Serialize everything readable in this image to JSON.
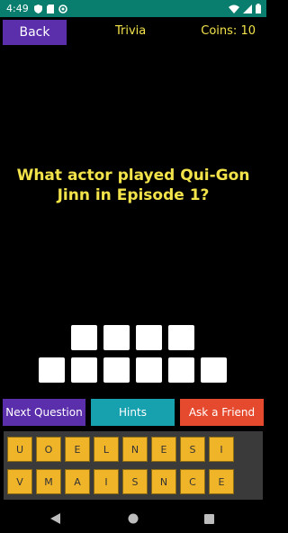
{
  "status_bar": {
    "time": "4:49",
    "icons": [
      "shield-icon",
      "sd-card-icon",
      "notification-icon",
      "wifi-icon",
      "signal-icon",
      "battery-icon"
    ]
  },
  "header": {
    "back_label": "Back",
    "title": "Trivia",
    "coins_label": "Coins: 10"
  },
  "question": {
    "text": "What actor played Qui-Gon Jinn in Episode 1?"
  },
  "answer": {
    "row1_slots": 4,
    "row2_slots": 6
  },
  "actions": {
    "next_label": "Next Question",
    "hints_label": "Hints",
    "friend_label": "Ask a Friend"
  },
  "letters": {
    "row1": [
      "U",
      "O",
      "E",
      "L",
      "N",
      "E",
      "S",
      "I"
    ],
    "row2": [
      "V",
      "M",
      "A",
      "I",
      "S",
      "N",
      "C",
      "E"
    ]
  },
  "colors": {
    "status_bar": "#0a7e6e",
    "accent_yellow": "#f3e34a",
    "purple": "#5b2eab",
    "teal": "#17a0ae",
    "orange_red": "#e64a2e",
    "letter_key": "#f0b429"
  },
  "nav_bar": {
    "icons": [
      "nav-back-icon",
      "nav-home-icon",
      "nav-recent-icon"
    ]
  }
}
